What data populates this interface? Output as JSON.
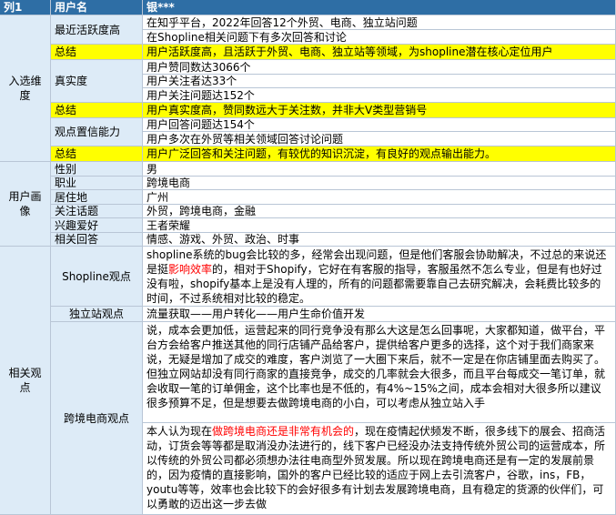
{
  "header": {
    "col1": "列1",
    "col2": "用户名",
    "col3": "银***"
  },
  "sections": {
    "selection": "入选维度",
    "portrait": "用户画像",
    "opinions": "相关观点"
  },
  "selection": {
    "activity_label": "最近活跃度高",
    "activity_lines": [
      "在知乎平台，2022年回答12个外贸、电商、独立站问题",
      "在Shopline相关问题下有多次回答和讨论"
    ],
    "summary_label_1": "总结",
    "summary_1": "用户活跃度高，且活跃于外贸、电商、独立站等领域，为shopline潜在核心定位用户",
    "authenticity_label": "真实度",
    "authenticity_lines": [
      "用户赞同数达3066个",
      "用户关注者达33个",
      "用户关注问题达152个"
    ],
    "summary_label_2": "总结",
    "summary_2": "用户真实度高，赞同数远大于关注数，并非大V类型营销号",
    "credibility_label": "观点置信能力",
    "credibility_lines": [
      "用户回答问题达154个",
      "用户多次在外贸等相关领域回答讨论问题"
    ],
    "summary_label_3": "总结",
    "summary_3": "用户广泛回答和关注问题，有较优的知识沉淀，有良好的观点输出能力。"
  },
  "portrait": {
    "rows": [
      {
        "label": "性别",
        "value": "男"
      },
      {
        "label": "职业",
        "value": "跨境电商"
      },
      {
        "label": "居住地",
        "value": "广州"
      },
      {
        "label": "关注话题",
        "value": "外贸，跨境电商，金融"
      },
      {
        "label": "兴趣爱好",
        "value": "王者荣耀"
      },
      {
        "label": "相关回答",
        "value": "情感、游戏、外贸、政治、时事"
      }
    ]
  },
  "opinions": {
    "shopline_label": "Shopline观点",
    "shopline_pre": "shopline系统的bug会比较的多，经常会出现问题，但是他们客服会协助解决，不过总的来说还是挺",
    "shopline_red": "影响效率",
    "shopline_post": "的，相对于Shopify，它好在有客服的指导，客服虽然不怎么专业，但是有也好过没有啦，shopify基本上是没有人理的，所有的问题都需要靠自己去研究解决，会耗费比较多的时间，不过系统相对比较的稳定。",
    "indie_label": "独立站观点",
    "indie_text": "流量获取——用户转化——用户生命价值开发",
    "cross_label": "跨境电商观点",
    "cross_text_1": "说，成本会更加低，运营起来的同行竞争没有那么大这是怎么回事呢，大家都知道，做平台，平台方会给客户推送其他的同行店铺产品给客户，提供给客户更多的选择，这个对于我们商家来说，无疑是增加了成交的难度，客户浏览了一大圈下来后，就不一定是在你店铺里面去购买了。但独立网站却没有同行商家的直接竞争，成交的几率就会大很多，而且平台每成交一笔订单，就会收取一笔的订单佣金，这个比率也是不低的，有4%~15%之间，成本会相对大很多所以建议很多预算不足，但是想要去做跨境电商的小白，可以考虑从独立站入手",
    "cross_text_2_pre": "本人认为现在",
    "cross_text_2_red": "做跨境电商还是非常有机会的",
    "cross_text_2_post": "，现在疫情起伏频发不断，很多线下的展会、招商活动，订货会等等都是取消没办法进行的，线下客户已经没办法支持传统外贸公司的运营成本，所以传统的外贸公司都必须想办法往电商型外贸发展。所以现在跨境电商还是有一定的发展前景的，因为疫情的直接影响，国外的客户已经比较的适应于网上去引流客户，谷歌，ins，FB，youtu等等，效率也会比较下的会好很多有计划去发展跨境电商，且有稳定的货源的伙伴们，可以勇敢的迈出这一步去做"
  }
}
